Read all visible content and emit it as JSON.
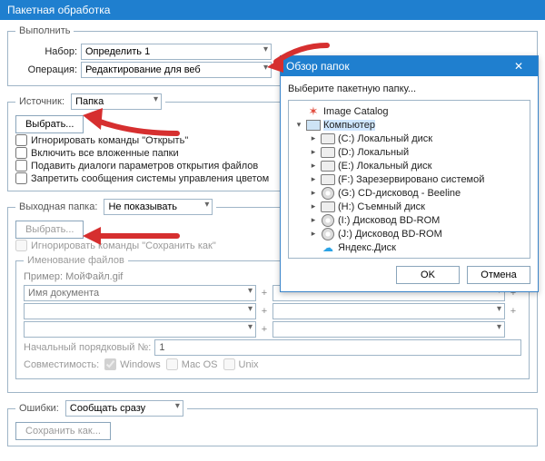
{
  "window": {
    "title": "Пакетная обработка"
  },
  "execute": {
    "legend": "Выполнить",
    "set_label": "Набор:",
    "set_value": "Определить 1",
    "op_label": "Операция:",
    "op_value": "Редактирование для веб"
  },
  "source": {
    "legend": "Источник:",
    "type": "Папка",
    "choose_btn": "Выбрать...",
    "chk_ignore_open": "Игнорировать команды \"Открыть\"",
    "chk_include_sub": "Включить все вложенные папки",
    "chk_suppress_open_dlg": "Подавить диалоги параметров открытия файлов",
    "chk_suppress_color": "Запретить сообщения системы управления цветом"
  },
  "dest": {
    "label": "Выходная папка:",
    "value": "Не показывать",
    "choose_btn": "Выбрать...",
    "chk_ignore_saveas": "Игнорировать команды \"Сохранить как\"",
    "naming_legend": "Именование файлов",
    "example_label": "Пример:",
    "example_value": "МойФайл.gif",
    "field_doc": "Имя документа",
    "start_num_label": "Начальный порядковый №:",
    "start_num_value": "1",
    "compat_label": "Совместимость:",
    "compat_win": "Windows",
    "compat_mac": "Mac OS",
    "compat_unix": "Unix"
  },
  "errors": {
    "label": "Ошибки:",
    "value": "Сообщать сразу",
    "saveas_btn": "Сохранить как..."
  },
  "dialog": {
    "title": "Обзор папок",
    "instruction": "Выберите пакетную папку...",
    "ok": "OK",
    "cancel": "Отмена",
    "tree": [
      {
        "depth": 0,
        "exp": "",
        "icon": "star",
        "label": "Image Catalog"
      },
      {
        "depth": 0,
        "exp": "▾",
        "icon": "pc",
        "label": "Компьютер",
        "selected": true
      },
      {
        "depth": 1,
        "exp": "▸",
        "icon": "drive",
        "label": "(C:) Локальный диск"
      },
      {
        "depth": 1,
        "exp": "▸",
        "icon": "drive",
        "label": "(D:) Локальный"
      },
      {
        "depth": 1,
        "exp": "▸",
        "icon": "drive",
        "label": "(E:) Локальный диск"
      },
      {
        "depth": 1,
        "exp": "▸",
        "icon": "drive",
        "label": "(F:) Зарезервировано системой"
      },
      {
        "depth": 1,
        "exp": "▸",
        "icon": "cd",
        "label": "(G:) CD-дисковод - Beeline"
      },
      {
        "depth": 1,
        "exp": "▸",
        "icon": "drive",
        "label": "(H:) Съемный диск"
      },
      {
        "depth": 1,
        "exp": "▸",
        "icon": "cd",
        "label": "(I:) Дисковод BD-ROM"
      },
      {
        "depth": 1,
        "exp": "▸",
        "icon": "cd",
        "label": "(J:) Дисковод BD-ROM"
      },
      {
        "depth": 1,
        "exp": "",
        "icon": "cloud",
        "label": "Яндекс.Диск"
      }
    ]
  }
}
